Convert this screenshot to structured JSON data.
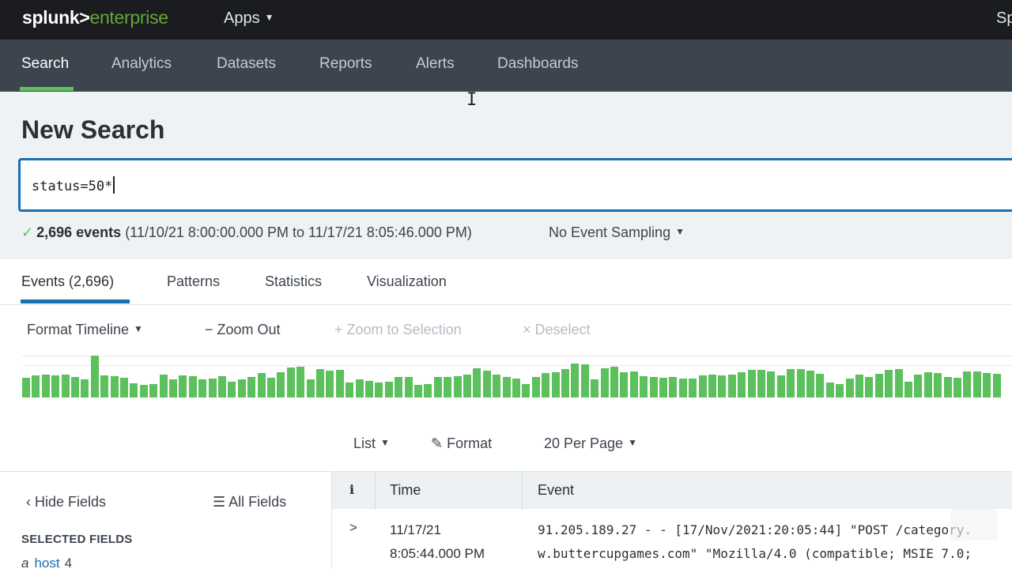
{
  "app": {
    "logo_primary": "splunk>",
    "logo_secondary": "enterprise",
    "apps_label": "Apps",
    "top_right_label": "Sp"
  },
  "nav": {
    "items": [
      {
        "label": "Search"
      },
      {
        "label": "Analytics"
      },
      {
        "label": "Datasets"
      },
      {
        "label": "Reports"
      },
      {
        "label": "Alerts"
      },
      {
        "label": "Dashboards"
      }
    ]
  },
  "search": {
    "title": "New Search",
    "query": "status=50*",
    "event_count": "2,696 events",
    "time_range": "(11/10/21 8:00:00.000 PM to 11/17/21 8:05:46.000 PM)",
    "sampling_label": "No Event Sampling"
  },
  "tabs": [
    {
      "label": "Events (2,696)"
    },
    {
      "label": "Patterns"
    },
    {
      "label": "Statistics"
    },
    {
      "label": "Visualization"
    }
  ],
  "timeline_controls": {
    "format_label": "Format Timeline",
    "zoom_out_label": "Zoom Out",
    "zoom_selection_label": "Zoom to Selection",
    "deselect_label": "Deselect"
  },
  "timeline_values": [
    24,
    27,
    28,
    27,
    28,
    25,
    22,
    51,
    27,
    26,
    24,
    17,
    15,
    16,
    28,
    22,
    27,
    26,
    22,
    23,
    26,
    19,
    22,
    25,
    30,
    24,
    31,
    37,
    38,
    22,
    35,
    33,
    34,
    18,
    22,
    20,
    18,
    19,
    25,
    25,
    15,
    16,
    25,
    25,
    26,
    28,
    36,
    33,
    28,
    25,
    23,
    16,
    25,
    30,
    31,
    35,
    41,
    40,
    22,
    36,
    38,
    31,
    32,
    26,
    25,
    24,
    25,
    23,
    23,
    27,
    28,
    27,
    28,
    31,
    34,
    34,
    32,
    27,
    35,
    35,
    33,
    29,
    18,
    16,
    23,
    28,
    25,
    29,
    34,
    35,
    19,
    28,
    31,
    30,
    25,
    24,
    32,
    32,
    30,
    29
  ],
  "timeline_max": 52,
  "view_controls": {
    "list_label": "List",
    "format_label": "Format",
    "per_page_label": "20 Per Page"
  },
  "fields_panel": {
    "hide_label": "Hide Fields",
    "all_label": "All Fields",
    "selected_header": "SELECTED FIELDS",
    "fields": [
      {
        "type": "a",
        "name": "host",
        "count": "4"
      }
    ]
  },
  "table": {
    "columns": {
      "info": "i",
      "time": "Time",
      "event": "Event"
    },
    "rows": [
      {
        "date": "11/17/21",
        "time": "8:05:44.000 PM",
        "event_line1": "91.205.189.27 - - [17/Nov/2021:20:05:44] \"POST /category.",
        "event_line2": "w.buttercupgames.com\" \"Mozilla/4.0 (compatible; MSIE 7.0;"
      }
    ]
  },
  "colors": {
    "accent_green": "#5cc05c",
    "accent_blue": "#1a6faf",
    "nav_bg": "#3c444d",
    "topbar_bg": "#1a1c20"
  }
}
